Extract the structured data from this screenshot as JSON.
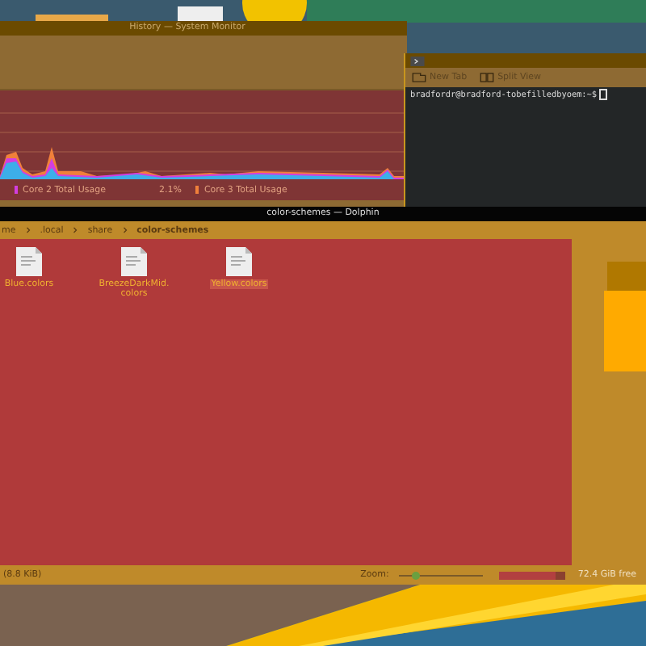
{
  "system_monitor": {
    "title": "History — System Monitor",
    "legend": [
      {
        "label": "Core 2 Total Usage",
        "reading": "2.1%",
        "color": "#d23ee0"
      },
      {
        "label": "Core 3 Total Usage",
        "color": "#f0803a"
      }
    ]
  },
  "terminal": {
    "toolbar": [
      {
        "kind": "tab",
        "label": "New Tab"
      },
      {
        "kind": "split",
        "label": "Split View"
      }
    ],
    "prompt": "bradfordr@bradford-tobefilledbyoem:~$"
  },
  "file_manager": {
    "title": "color-schemes — Dolphin",
    "breadcrumbs": [
      {
        "label": "me",
        "selected": false
      },
      {
        "label": ".local",
        "selected": false
      },
      {
        "label": "share",
        "selected": false
      },
      {
        "label": "color-schemes",
        "selected": true
      }
    ],
    "files": [
      {
        "name": "Blue.colors",
        "selected": false
      },
      {
        "name": "BreezeDarkMid.\ncolors",
        "selected": false
      },
      {
        "name": "Yellow.colors",
        "selected": true
      }
    ],
    "status_bar": {
      "info": "(8.8 KiB)",
      "zoom_label": "Zoom:",
      "zoom": {
        "level": 0.2
      },
      "space": {
        "level": 0.85
      },
      "free": "72.4 GiB free"
    }
  }
}
